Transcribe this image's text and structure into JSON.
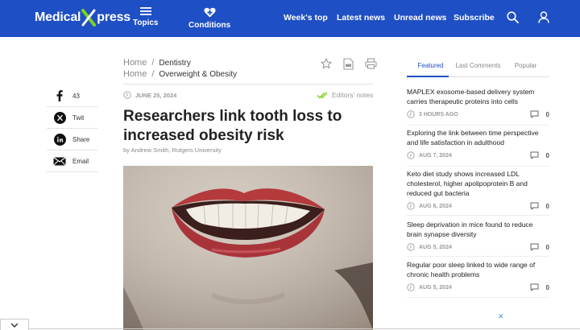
{
  "header": {
    "logo_left": "Medical",
    "logo_right": "press",
    "nav": {
      "topics": "Topics",
      "conditions": "Conditions",
      "weeks_top": "Week's top",
      "latest_news": "Latest news",
      "unread_news": "Unread news",
      "subscribe": "Subscribe"
    },
    "icons": {
      "search": "search-icon",
      "user": "user-icon",
      "menu": "menu-icon",
      "conditions": "medical-plus-icon"
    },
    "brand_color": "#1f4fc4"
  },
  "breadcrumbs": [
    {
      "home": "Home",
      "sep": "/",
      "label": "Dentistry"
    },
    {
      "home": "Home",
      "sep": "/",
      "label": "Overweight & Obesity"
    }
  ],
  "article": {
    "date": "JUNE 25, 2024",
    "editors_notes": "Editors' notes",
    "title": "Researchers link tooth loss to increased obesity risk",
    "byline": "by Andrew Smith, Rutgers University"
  },
  "social": {
    "facebook": {
      "label": "43",
      "icon": "facebook-icon"
    },
    "twitter": {
      "label": "Twit",
      "icon": "x-twitter-icon"
    },
    "linkedin": {
      "label": "Share",
      "icon": "linkedin-icon"
    },
    "email": {
      "label": "Email",
      "icon": "email-icon"
    }
  },
  "sidebar": {
    "tabs": [
      "Featured",
      "Last Comments",
      "Popular"
    ],
    "stories": [
      {
        "title": "MAPLEX exosome-based delivery system carries therapeutic proteins into cells",
        "time": "3 HOURS AGO",
        "comments": "0"
      },
      {
        "title": "Exploring the link between time perspective and life satisfaction in adulthood",
        "time": "AUG 7, 2024",
        "comments": "0"
      },
      {
        "title": "Keto diet study shows increased LDL cholesterol, higher apolipoprotein B and reduced gut bacteria",
        "time": "AUG 6, 2024",
        "comments": "0"
      },
      {
        "title": "Sleep deprivation in mice found to reduce brain synapse diversity",
        "time": "AUG 5, 2024",
        "comments": "0"
      },
      {
        "title": "Regular poor sleep linked to wide range of chronic health problems",
        "time": "AUG 5, 2024",
        "comments": "0"
      }
    ]
  },
  "ad": {
    "close": "✕"
  }
}
